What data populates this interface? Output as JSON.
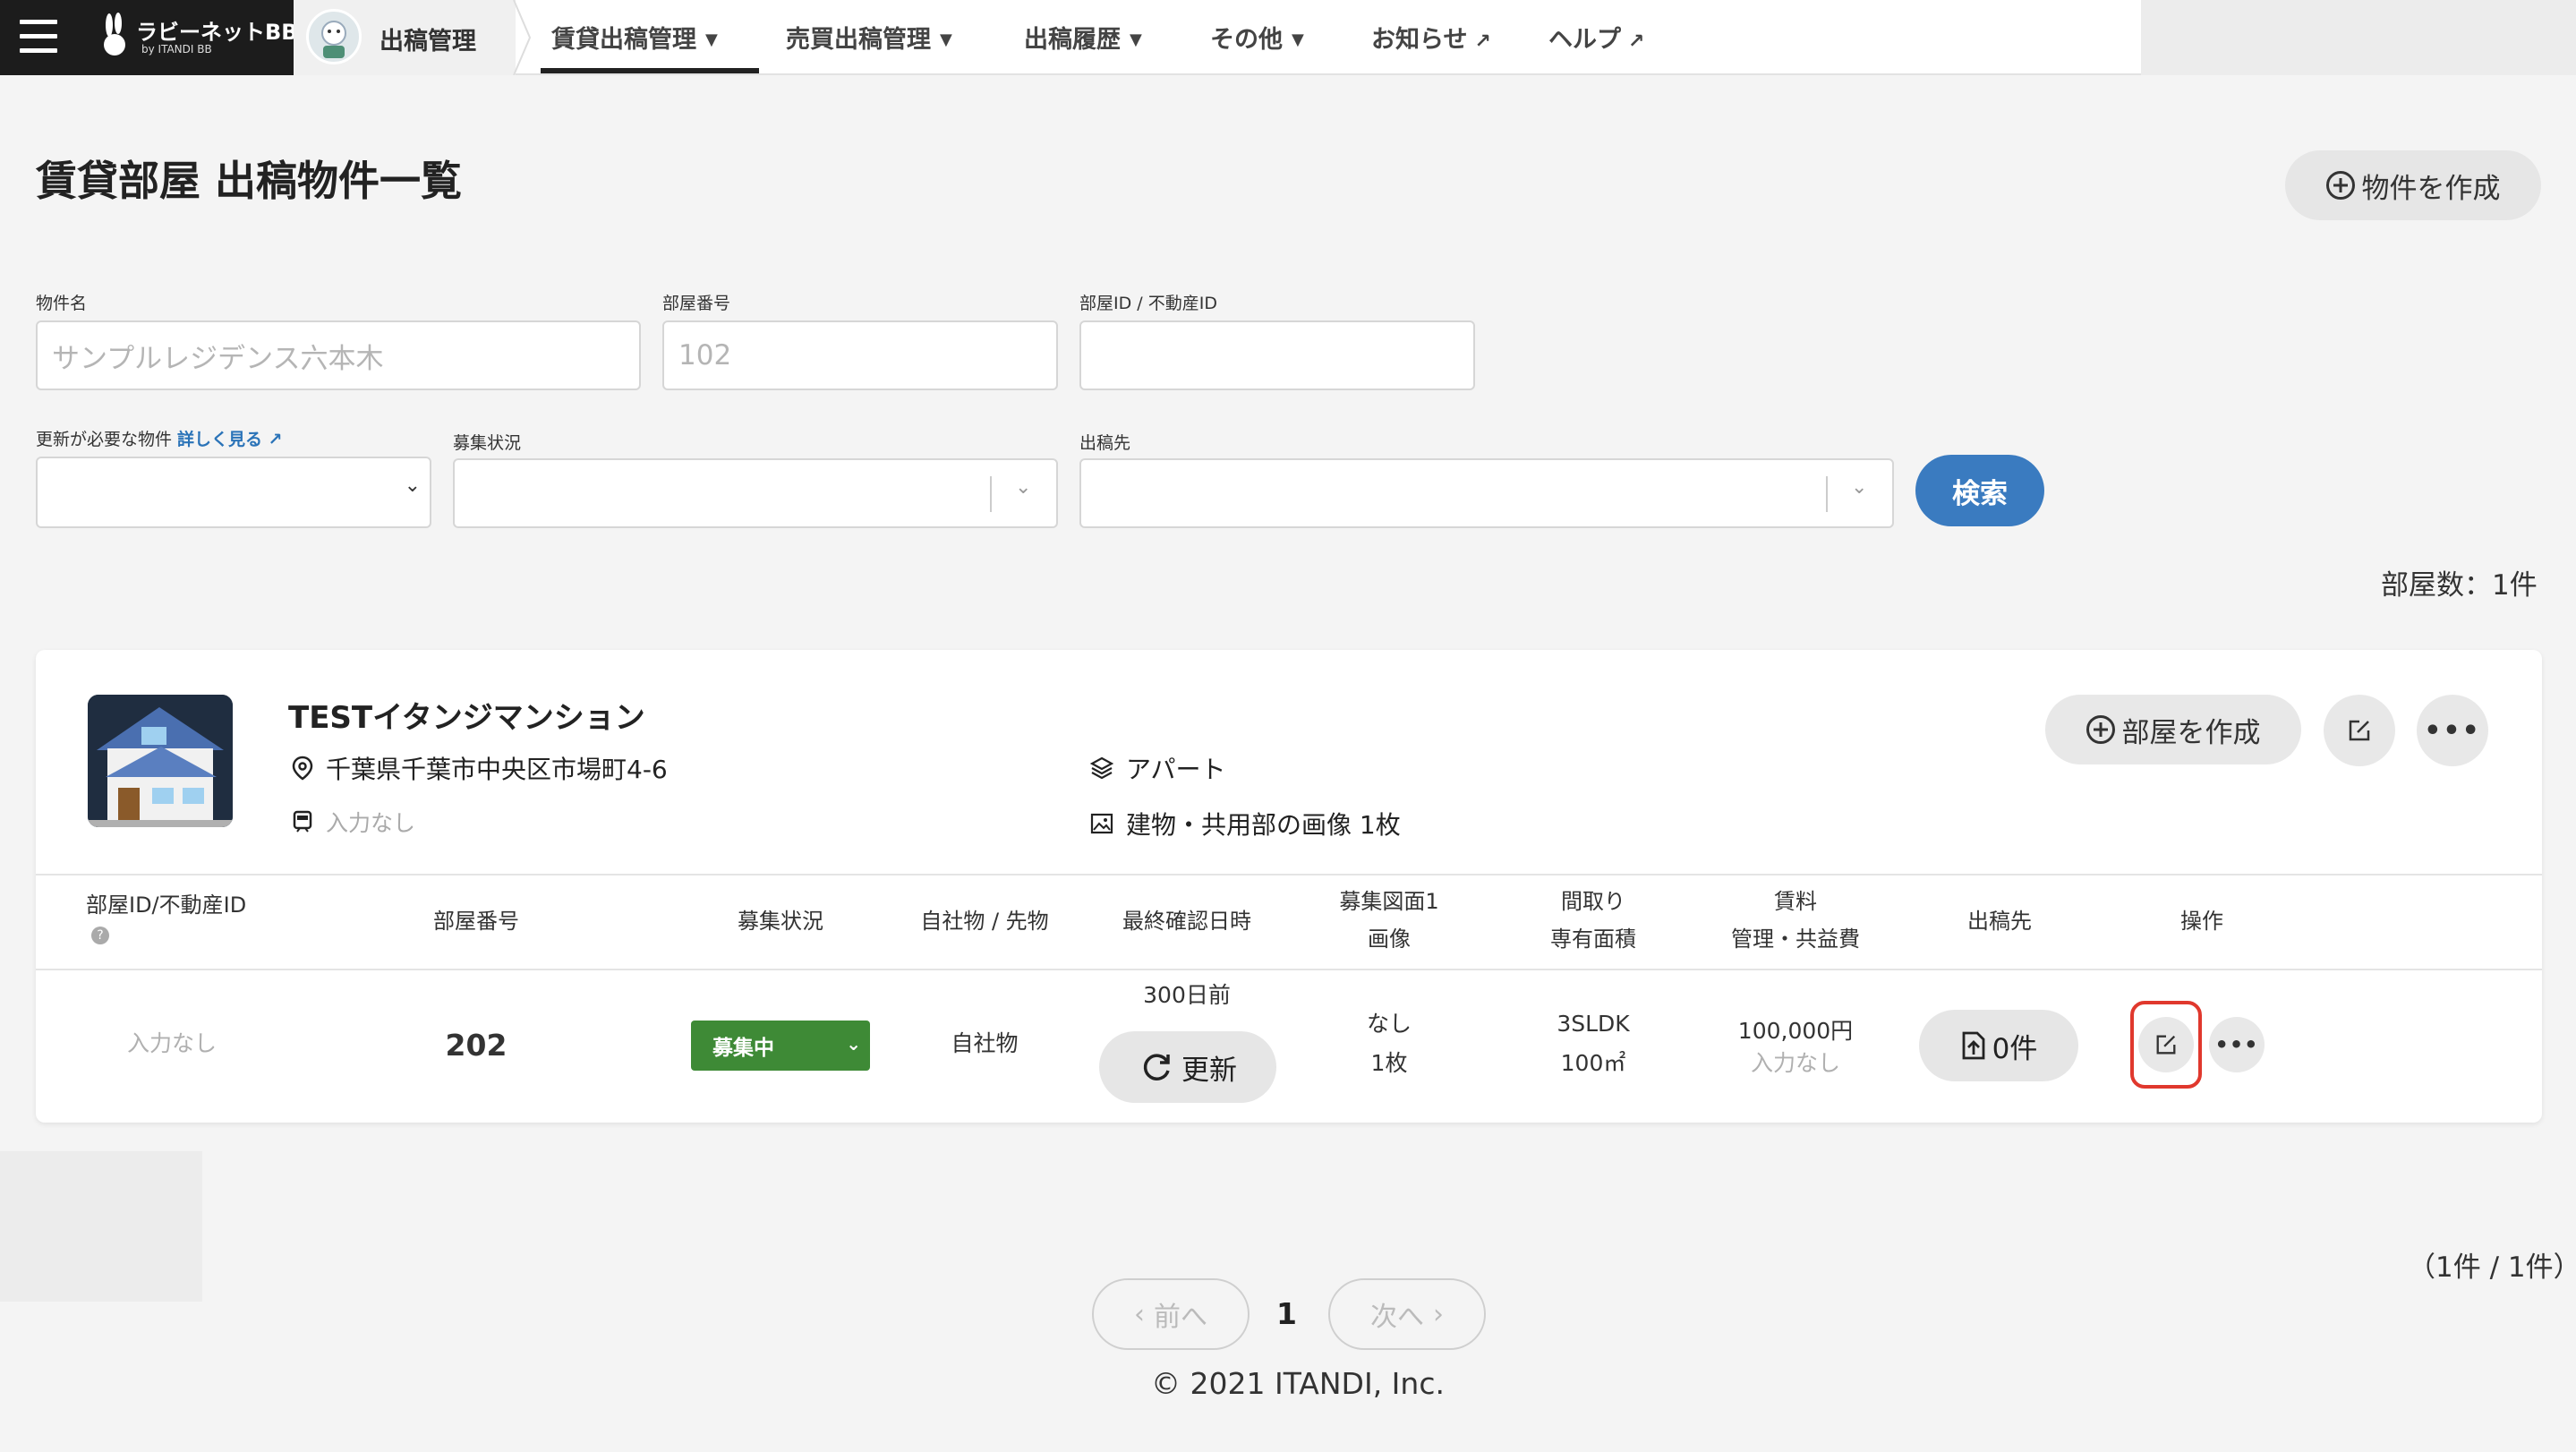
{
  "header": {
    "brand": {
      "name": "ラビーネットBB",
      "sub": "by ITANDI BB"
    },
    "home_label": "出稿管理",
    "nav": [
      {
        "label": "賃貸出稿管理",
        "icon": "chevron-down-icon"
      },
      {
        "label": "売買出稿管理",
        "icon": "chevron-down-icon"
      },
      {
        "label": "出稿履歴",
        "icon": "chevron-down-icon"
      },
      {
        "label": "その他",
        "icon": "chevron-down-icon"
      },
      {
        "label": "お知らせ",
        "icon": "external-link-icon"
      },
      {
        "label": "ヘルプ",
        "icon": "external-link-icon"
      }
    ]
  },
  "page": {
    "title": "賃貸部屋 出稿物件一覧",
    "create_button": "物件を作成"
  },
  "filters": {
    "property_name": {
      "label": "物件名",
      "placeholder": "サンプルレジデンス六本木"
    },
    "room_number": {
      "label": "部屋番号",
      "placeholder": "102"
    },
    "room_id": {
      "label": "部屋ID / 不動産ID",
      "placeholder": ""
    },
    "needs_update": {
      "label": "更新が必要な物件",
      "link": "詳しく見る"
    },
    "recruit_status": {
      "label": "募集状況"
    },
    "destination": {
      "label": "出稿先"
    },
    "search_button": "検索"
  },
  "room_count": "部屋数：1件",
  "property": {
    "name": "TESTイタンジマンション",
    "address": "千葉県千葉市中央区市場町4-6",
    "station": "入力なし",
    "building_type": "アパート",
    "images": "建物・共用部の画像 1枚",
    "create_room_button": "部屋を作成"
  },
  "table": {
    "headers": {
      "room_id": "部屋ID/不動産ID",
      "room_no": "部屋番号",
      "status": "募集状況",
      "own": "自社物 / 先物",
      "last_confirm": "最終確認日時",
      "floorplan_1": "募集図面1",
      "floorplan_2": "画像",
      "layout_1": "間取り",
      "layout_2": "専有面積",
      "rent_1": "賃料",
      "rent_2": "管理・共益費",
      "dest": "出稿先",
      "ops": "操作"
    },
    "row": {
      "room_id": "入力なし",
      "room_no": "202",
      "status": "募集中",
      "own": "自社物",
      "last_confirm": "300日前",
      "refresh": "更新",
      "floorplan": "なし",
      "images": "1枚",
      "layout": "3SLDK",
      "area": "100㎡",
      "rent": "100,000円",
      "fee": "入力なし",
      "dest_count": "0件"
    }
  },
  "pagination": {
    "info": "（1件 / 1件）",
    "prev": "前へ",
    "next": "次へ",
    "current": "1"
  },
  "footer": {
    "copyright": "© 2021 ITANDI, Inc."
  },
  "colors": {
    "accent": "#3a7bc0",
    "status_green": "#3e8a36",
    "highlight_red": "#e0382d"
  }
}
